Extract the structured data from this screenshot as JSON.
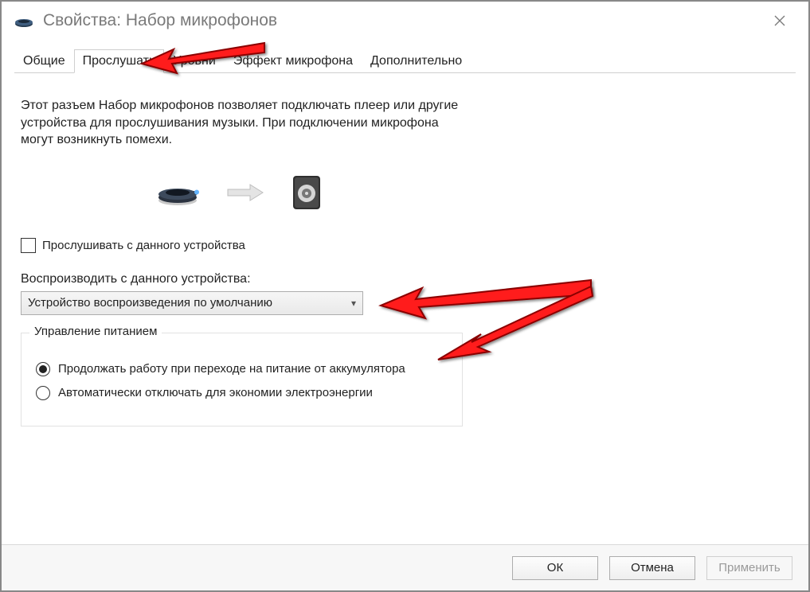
{
  "window": {
    "title": "Свойства: Набор микрофонов"
  },
  "tabs": [
    {
      "id": "general",
      "label": "Общие"
    },
    {
      "id": "listen",
      "label": "Прослушать"
    },
    {
      "id": "levels",
      "label": "Уровни"
    },
    {
      "id": "mic-fx",
      "label": "Эффект микрофона"
    },
    {
      "id": "advanced",
      "label": "Дополнительно"
    }
  ],
  "active_tab": "listen",
  "listen": {
    "description": "Этот разъем Набор микрофонов позволяет подключать плеер или другие устройства для прослушивания музыки. При подключении микрофона могут возникнуть помехи.",
    "listen_checkbox_label": "Прослушивать с данного устройства",
    "listen_checked": false,
    "playback_label": "Воспроизводить с данного устройства:",
    "playback_value": "Устройство воспроизведения по умолчанию",
    "power_group_label": "Управление питанием",
    "radio_continue": "Продолжать работу при переходе на питание от аккумулятора",
    "radio_auto_off": "Автоматически отключать для экономии электроэнергии",
    "power_selected": "continue"
  },
  "buttons": {
    "ok": "ОК",
    "cancel": "Отмена",
    "apply": "Применить"
  }
}
